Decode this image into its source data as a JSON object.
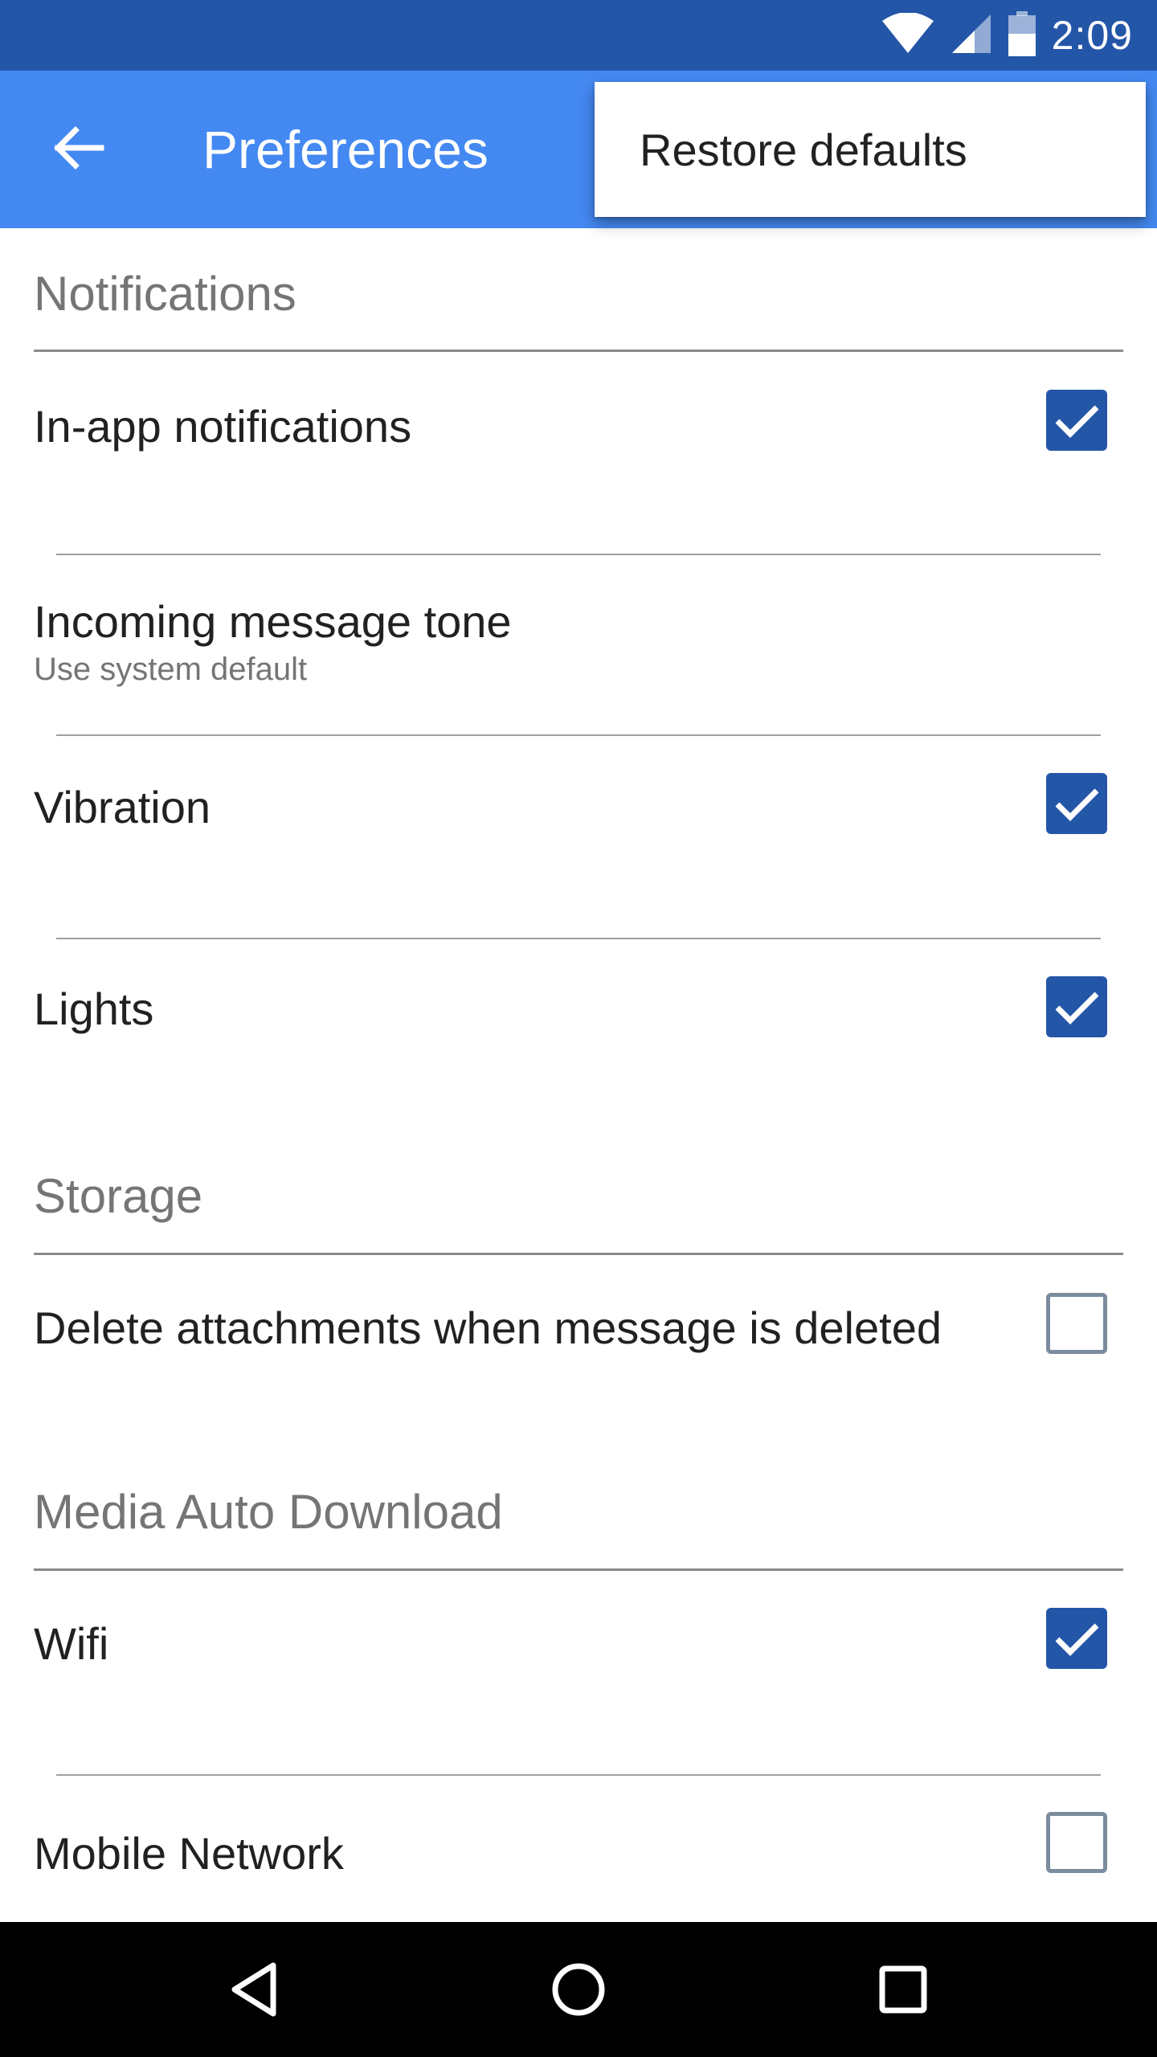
{
  "status_bar": {
    "time": "2:09",
    "icons": [
      "wifi-icon",
      "signal-icon",
      "battery-icon"
    ]
  },
  "app_bar": {
    "title": "Preferences",
    "back_icon": "arrow-back-icon"
  },
  "overflow_menu": {
    "items": [
      {
        "label": "Restore defaults"
      }
    ]
  },
  "sections": [
    {
      "title": "Notifications",
      "items": [
        {
          "title": "In-app notifications",
          "type": "checkbox",
          "checked": true
        },
        {
          "title": "Incoming message tone",
          "summary": "Use system default",
          "type": "link"
        },
        {
          "title": "Vibration",
          "type": "checkbox",
          "checked": true
        },
        {
          "title": "Lights",
          "type": "checkbox",
          "checked": true
        }
      ]
    },
    {
      "title": "Storage",
      "items": [
        {
          "title": "Delete attachments when message is deleted",
          "type": "checkbox",
          "checked": false
        }
      ]
    },
    {
      "title": "Media Auto Download",
      "items": [
        {
          "title": "Wifi",
          "type": "checkbox",
          "checked": true
        },
        {
          "title": "Mobile Network",
          "type": "checkbox",
          "checked": false
        }
      ]
    }
  ],
  "nav_bar": {
    "buttons": [
      "back-triangle-icon",
      "home-circle-icon",
      "recents-square-icon"
    ]
  },
  "colors": {
    "status_bar": "#2456a8",
    "app_bar": "#4489f2",
    "checkbox_checked": "#2456a8",
    "checkbox_unchecked_border": "#7b8c9e",
    "section_header": "#757575"
  }
}
